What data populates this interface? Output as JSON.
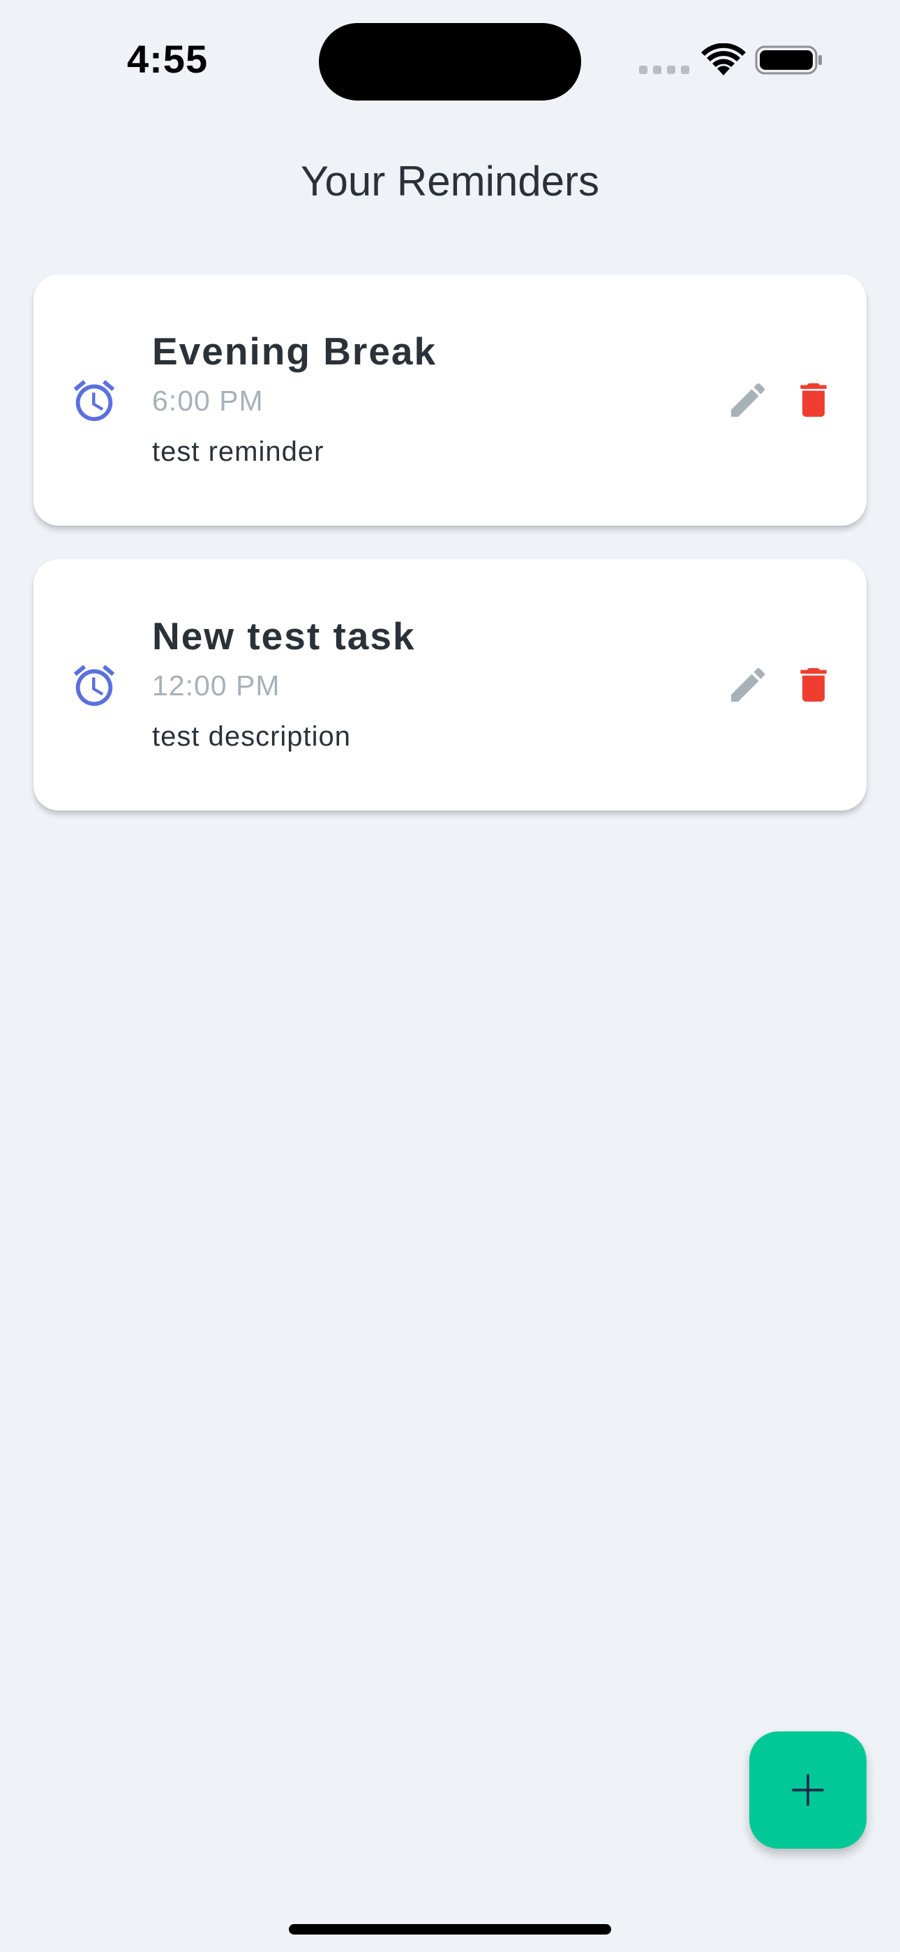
{
  "status_bar": {
    "time": "4:55"
  },
  "header": {
    "title": "Your Reminders"
  },
  "reminders": [
    {
      "title": "Evening Break",
      "time": "6:00 PM",
      "description": "test reminder",
      "icon": "alarm-clock-icon"
    },
    {
      "title": "New test task",
      "time": "12:00 PM",
      "description": "test description",
      "icon": "alarm-clock-icon"
    }
  ],
  "icons": {
    "edit": "pencil-icon",
    "delete": "trash-icon",
    "add": "plus-icon"
  },
  "colors": {
    "background": "#eff2f7",
    "card": "#ffffff",
    "alarm_icon": "#5a6fe0",
    "edit_icon": "#a7b1b8",
    "delete_icon": "#ef3e2f",
    "fab": "#00c896",
    "fab_icon": "#1c2a4a",
    "title_text": "#2b3138",
    "time_text": "#a7b1b8"
  }
}
